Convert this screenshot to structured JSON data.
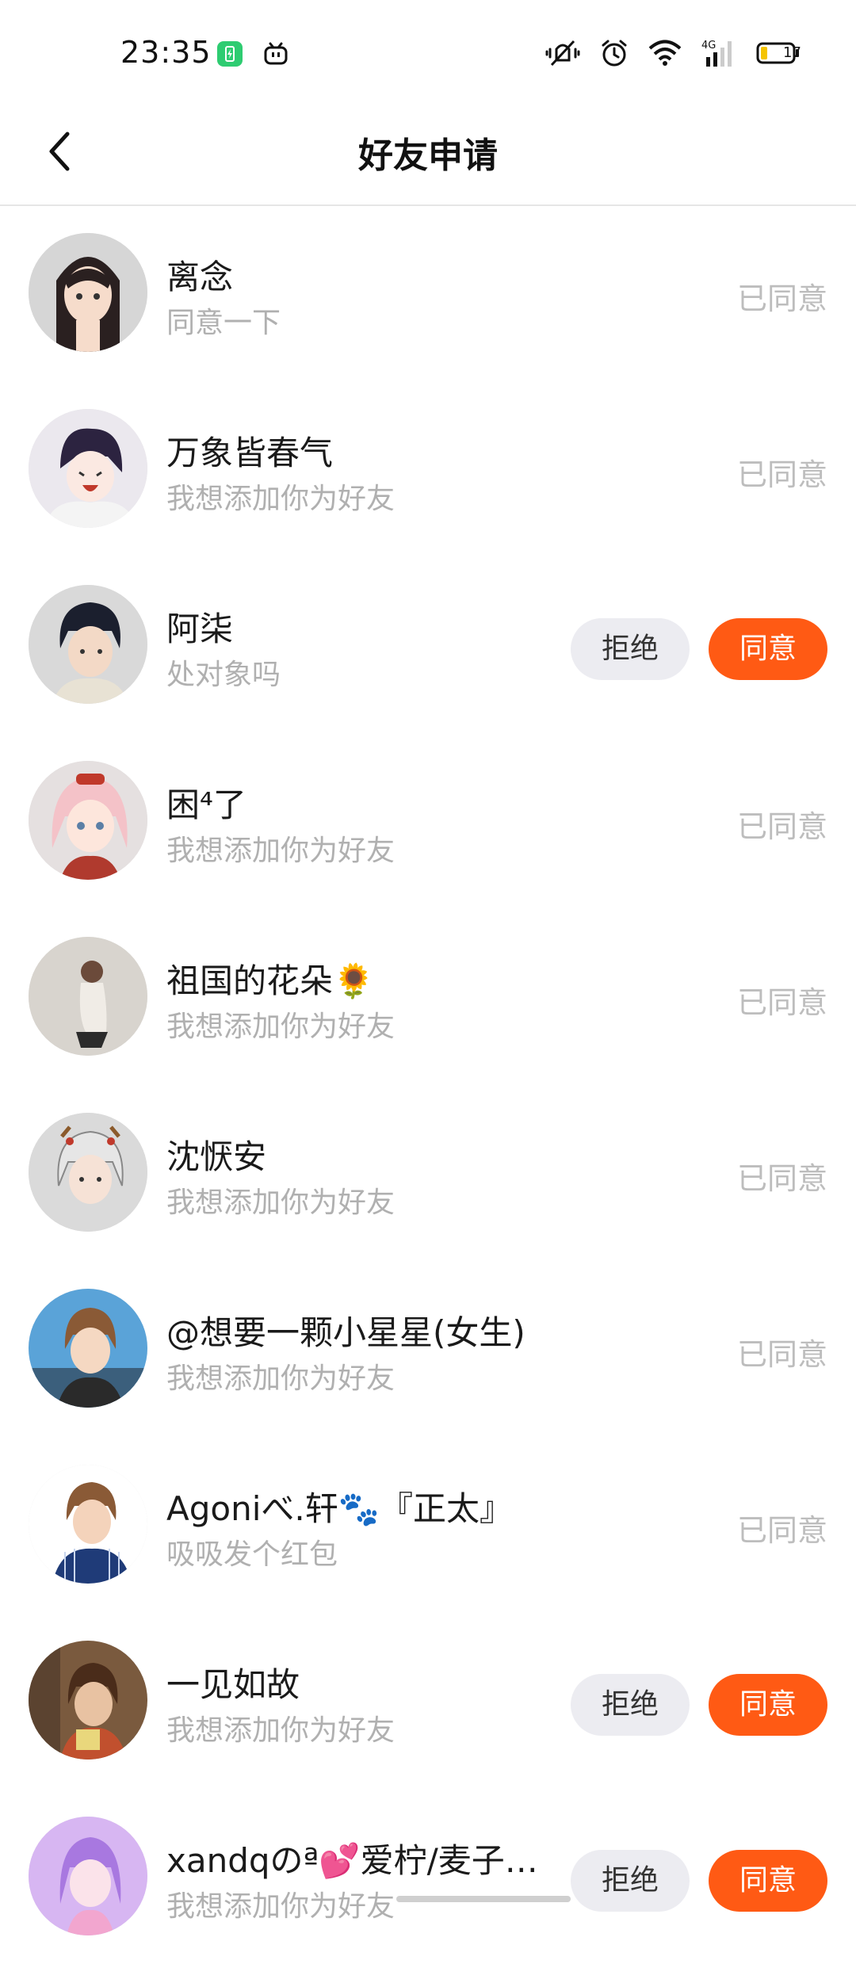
{
  "status_bar": {
    "time": "23:35",
    "battery_level": "17"
  },
  "header": {
    "title": "好友申请"
  },
  "labels": {
    "agreed": "已同意",
    "reject": "拒绝",
    "accept": "同意"
  },
  "requests": [
    {
      "name": "离念",
      "message": "同意一下",
      "status": "已同意"
    },
    {
      "name": "万象皆春气",
      "message": "我想添加你为好友",
      "status": "已同意"
    },
    {
      "name": "阿柒",
      "message": "处对象吗",
      "status": "pending"
    },
    {
      "name": "困⁴了",
      "message": "我想添加你为好友",
      "status": "已同意"
    },
    {
      "name": "祖国的花朵🌻",
      "message": "我想添加你为好友",
      "status": "已同意"
    },
    {
      "name": "沈恹安",
      "message": "我想添加你为好友",
      "status": "已同意"
    },
    {
      "name": "@想要一颗小星星(女生)",
      "message": "我想添加你为好友",
      "status": "已同意"
    },
    {
      "name": "Agoniべ.轩🐾『正太』",
      "message": "吸吸发个红包",
      "status": "已同意"
    },
    {
      "name": "一见如故",
      "message": "我想添加你为好友",
      "status": "pending"
    },
    {
      "name": "xandqのª💕爱柠/麦子…",
      "message": "我想添加你为好友",
      "status": "pending"
    }
  ],
  "colors": {
    "accept": "#ff5a14",
    "reject_bg": "#ececf1",
    "agreed_text": "#bdbdbd"
  }
}
